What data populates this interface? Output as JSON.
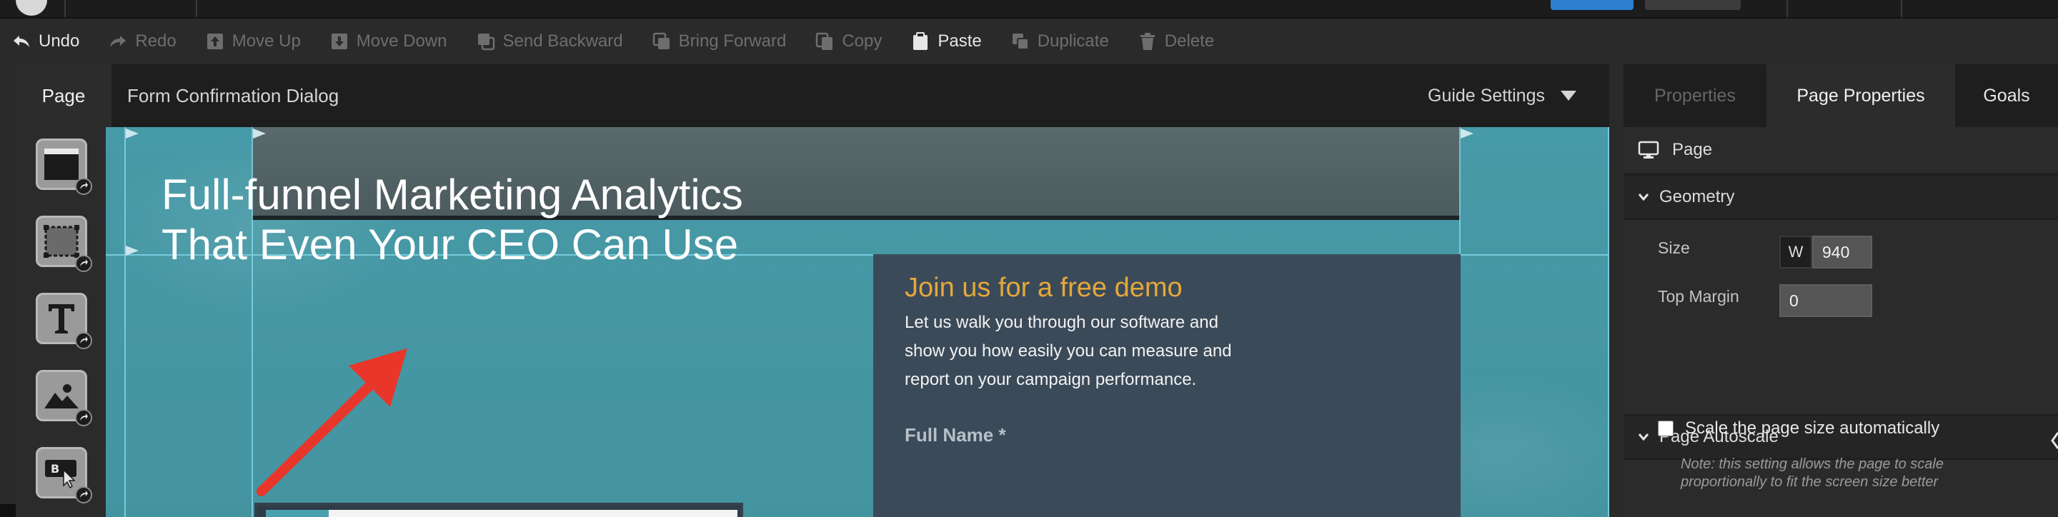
{
  "toolbar": {
    "items": [
      {
        "label": "Undo",
        "icon": "undo-icon",
        "enabled": true
      },
      {
        "label": "Redo",
        "icon": "redo-icon",
        "enabled": false
      },
      {
        "label": "Move Up",
        "icon": "move-up-icon",
        "enabled": false
      },
      {
        "label": "Move Down",
        "icon": "move-down-icon",
        "enabled": false
      },
      {
        "label": "Send Backward",
        "icon": "send-backward-icon",
        "enabled": false
      },
      {
        "label": "Bring Forward",
        "icon": "bring-forward-icon",
        "enabled": false
      },
      {
        "label": "Copy",
        "icon": "copy-icon",
        "enabled": false
      },
      {
        "label": "Paste",
        "icon": "paste-icon",
        "enabled": true
      },
      {
        "label": "Duplicate",
        "icon": "duplicate-icon",
        "enabled": false
      },
      {
        "label": "Delete",
        "icon": "trash-icon",
        "enabled": false
      }
    ]
  },
  "editor": {
    "page_tab": "Page",
    "page_name": "Form Confirmation Dialog",
    "guide_settings": "Guide Settings"
  },
  "palette": {
    "widgets": [
      "section-widget",
      "box-widget",
      "text-widget",
      "image-widget",
      "button-widget"
    ]
  },
  "canvas": {
    "headline": "Full-funnel Marketing Analytics That Even Your CEO Can Use",
    "form_title": "Join us for a free demo",
    "form_body": "Let us walk you through our software and show you how easily you can measure and report on your campaign performance.",
    "form_label": "Full Name *"
  },
  "properties": {
    "tabs": [
      "Properties",
      "Page Properties",
      "Goals"
    ],
    "active_tab": "Page Properties",
    "page_row": "Page",
    "geometry": {
      "title": "Geometry",
      "size_label": "Size",
      "w_label": "W",
      "width_value": "940",
      "top_margin_label": "Top Margin",
      "top_margin_value": "0"
    },
    "autoscale": {
      "title": "Page Autoscale",
      "checkbox_label": "Scale the page size automatically",
      "checked": false,
      "note": "Note: this setting allows the page to scale proportionally to fit the screen size better"
    }
  },
  "colors": {
    "canvas_teal": "#4aa0ae",
    "form_panel": "#3b4a59",
    "form_title": "#e4a83a",
    "annotation_arrow": "#e8362a",
    "publish_button": "#2d7fd0"
  }
}
